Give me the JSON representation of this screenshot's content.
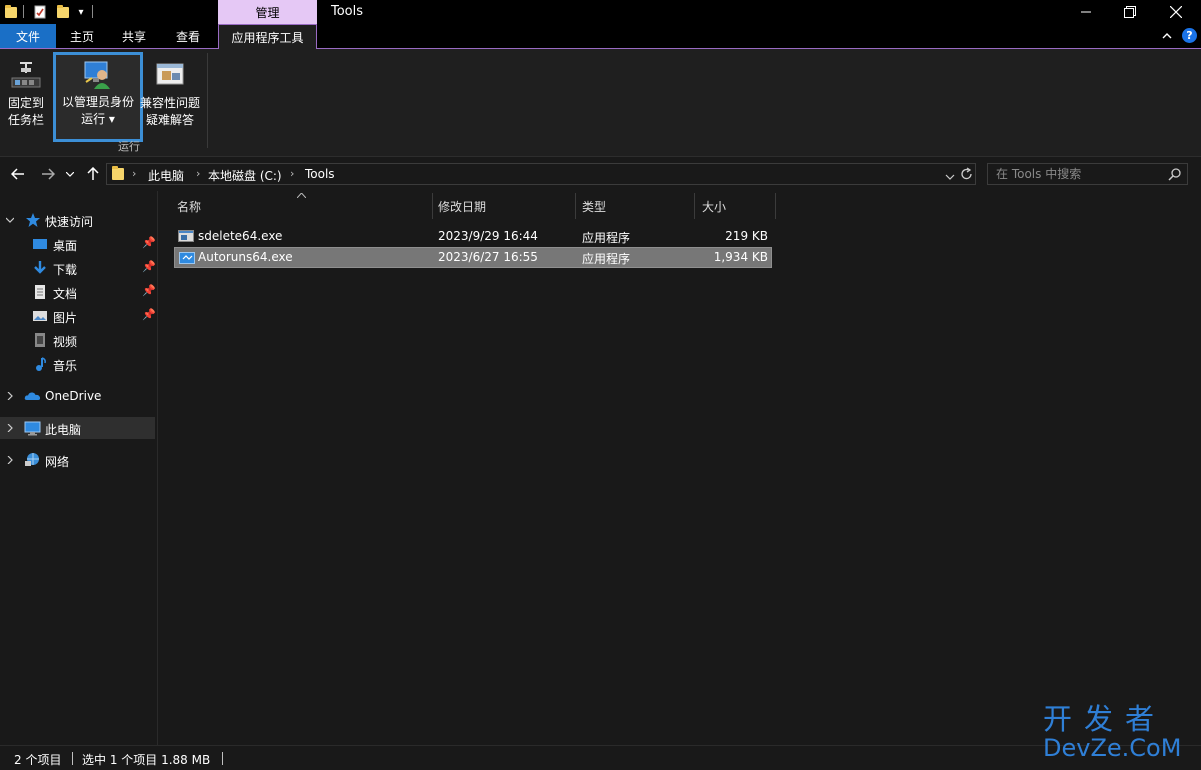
{
  "titlebar": {
    "context_tab": "管理",
    "title": "Tools",
    "minimize": "—",
    "restore": "❐",
    "close": "✕"
  },
  "ribbon_tabs": {
    "file": "文件",
    "home": "主页",
    "share": "共享",
    "view": "查看",
    "app_tools": "应用程序工具"
  },
  "ribbon": {
    "pin_taskbar": {
      "line1": "固定到",
      "line2": "任务栏"
    },
    "run_as_admin": {
      "line1": "以管理员身份",
      "line2": "运行 ▾"
    },
    "compat_troubleshoot": {
      "line1": "兼容性问题",
      "line2": "疑难解答"
    },
    "group_label": "运行",
    "collapse_icon": "^",
    "help_icon": "?"
  },
  "navigation": {
    "back": "←",
    "forward": "→",
    "recent": "⌄",
    "up": "↑",
    "breadcrumb": [
      "此电脑",
      "本地磁盘 (C:)",
      "Tools"
    ],
    "dropdown": "⌄",
    "refresh": "↻",
    "search_placeholder": "在 Tools 中搜索"
  },
  "sidebar": {
    "quick_access": "快速访问",
    "quick_items": [
      {
        "label": "桌面",
        "icon": "desktop-icon",
        "pinned": true
      },
      {
        "label": "下载",
        "icon": "download-icon",
        "pinned": true
      },
      {
        "label": "文档",
        "icon": "document-icon",
        "pinned": true
      },
      {
        "label": "图片",
        "icon": "pictures-icon",
        "pinned": true
      },
      {
        "label": "视频",
        "icon": "video-icon",
        "pinned": false
      },
      {
        "label": "音乐",
        "icon": "music-icon",
        "pinned": false
      }
    ],
    "onedrive": "OneDrive",
    "this_pc": "此电脑",
    "network": "网络"
  },
  "columns": {
    "name": "名称",
    "modified": "修改日期",
    "type": "类型",
    "size": "大小"
  },
  "files": [
    {
      "name": "sdelete64.exe",
      "modified": "2023/9/29 16:44",
      "type": "应用程序",
      "size": "219 KB",
      "selected": false
    },
    {
      "name": "Autoruns64.exe",
      "modified": "2023/6/27 16:55",
      "type": "应用程序",
      "size": "1,934 KB",
      "selected": true
    }
  ],
  "status": {
    "item_count": "2 个项目",
    "selection": "选中 1 个项目  1.88 MB"
  },
  "watermark": {
    "top": "开发者",
    "bottom": "DevZe.CoM"
  },
  "colors": {
    "accent": "#1a6fc6",
    "context_tab": "#e5c8f5",
    "selection": "#777777",
    "background": "#191919"
  }
}
